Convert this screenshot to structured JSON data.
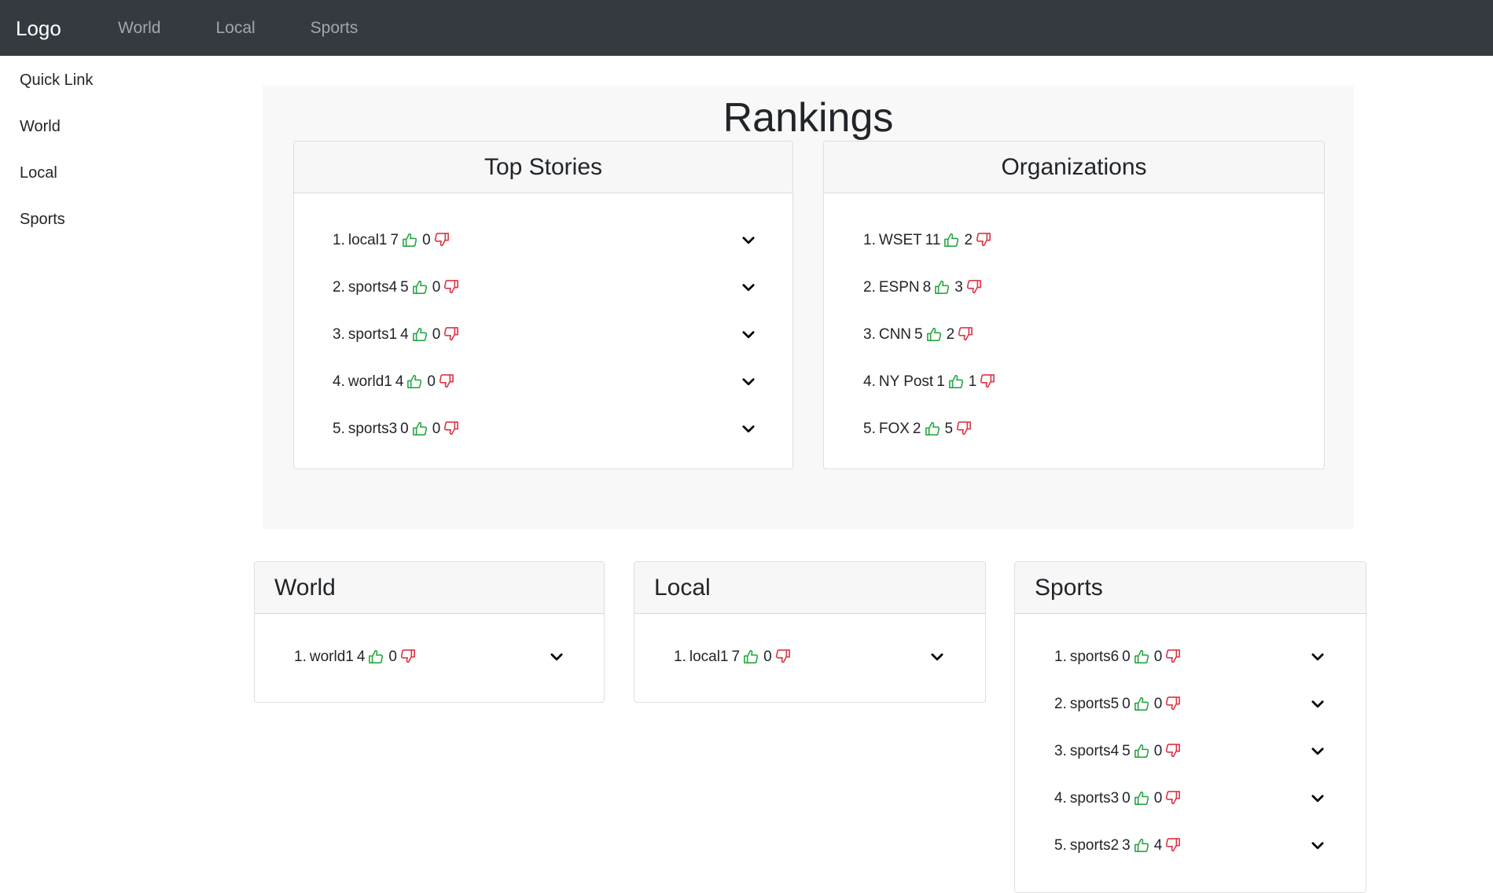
{
  "navbar": {
    "logo": "Logo",
    "links": [
      "World",
      "Local",
      "Sports"
    ]
  },
  "sidebar": {
    "links": [
      "Quick Link",
      "World",
      "Local",
      "Sports"
    ]
  },
  "rankings": {
    "title": "Rankings",
    "top_stories": {
      "title": "Top Stories",
      "items": [
        {
          "rank": "1.",
          "name": "local1",
          "up": "7",
          "down": "0"
        },
        {
          "rank": "2.",
          "name": "sports4",
          "up": "5",
          "down": "0"
        },
        {
          "rank": "3.",
          "name": "sports1",
          "up": "4",
          "down": "0"
        },
        {
          "rank": "4.",
          "name": "world1",
          "up": "4",
          "down": "0"
        },
        {
          "rank": "5.",
          "name": "sports3",
          "up": "0",
          "down": "0"
        }
      ]
    },
    "organizations": {
      "title": "Organizations",
      "items": [
        {
          "rank": "1.",
          "name": "WSET",
          "up": "11",
          "down": "2"
        },
        {
          "rank": "2.",
          "name": "ESPN",
          "up": "8",
          "down": "3"
        },
        {
          "rank": "3.",
          "name": "CNN",
          "up": "5",
          "down": "2"
        },
        {
          "rank": "4.",
          "name": "NY Post",
          "up": "1",
          "down": "1"
        },
        {
          "rank": "5.",
          "name": "FOX",
          "up": "2",
          "down": "5"
        }
      ]
    }
  },
  "sections": {
    "world": {
      "title": "World",
      "items": [
        {
          "rank": "1.",
          "name": "world1",
          "up": "4",
          "down": "0"
        }
      ]
    },
    "local": {
      "title": "Local",
      "items": [
        {
          "rank": "1.",
          "name": "local1",
          "up": "7",
          "down": "0"
        }
      ]
    },
    "sports": {
      "title": "Sports",
      "items": [
        {
          "rank": "1.",
          "name": "sports6",
          "up": "0",
          "down": "0"
        },
        {
          "rank": "2.",
          "name": "sports5",
          "up": "0",
          "down": "0"
        },
        {
          "rank": "3.",
          "name": "sports4",
          "up": "5",
          "down": "0"
        },
        {
          "rank": "4.",
          "name": "sports3",
          "up": "0",
          "down": "0"
        },
        {
          "rank": "5.",
          "name": "sports2",
          "up": "3",
          "down": "4"
        }
      ]
    }
  },
  "colors": {
    "navbar_bg": "#343a40",
    "thumbs_up": "#28a745",
    "thumbs_down": "#dc3545",
    "panel_bg": "#f8f8f8"
  },
  "icons": {
    "up": "thumbs-up-icon",
    "down": "thumbs-down-icon",
    "expand": "chevron-down-icon"
  }
}
